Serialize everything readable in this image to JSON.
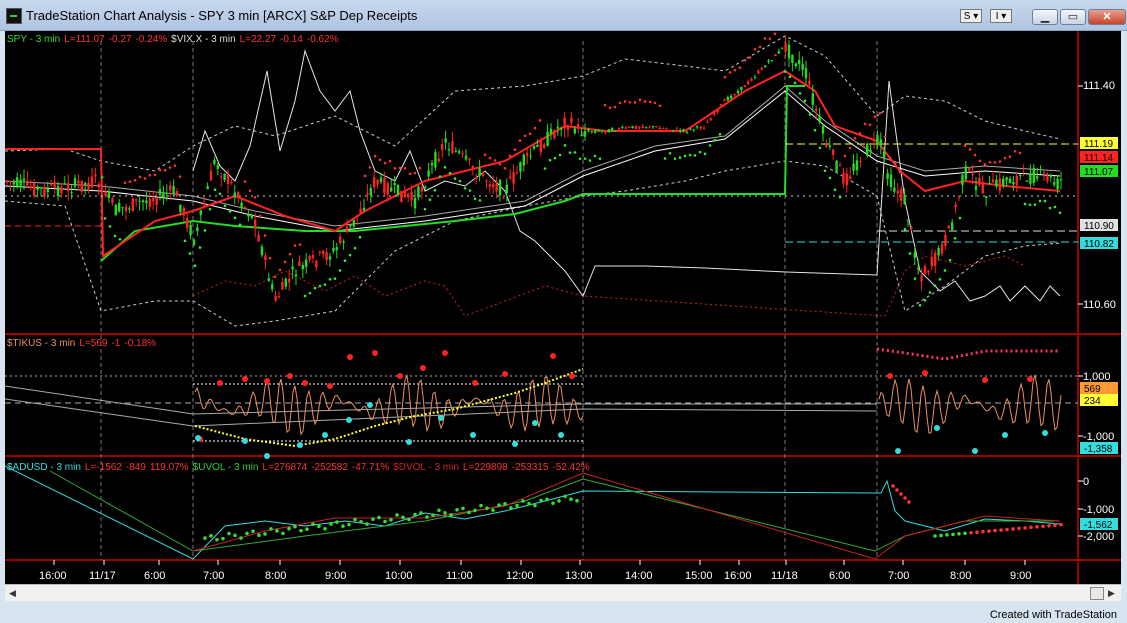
{
  "window": {
    "title": "TradeStation Chart Analysis - SPY 3 min [ARCX] S&P Dep Receipts",
    "symbol_button": "S",
    "layout_button": "I"
  },
  "pane1": {
    "legend": [
      {
        "text": "SPY - 3 min",
        "color": "#33dd33"
      },
      {
        "text": "L=111.07",
        "color": "#ff3333"
      },
      {
        "text": "-0.27",
        "color": "#ff3333"
      },
      {
        "text": "-0.24%",
        "color": "#ff3333"
      },
      {
        "text": "$VIX.X - 3 min",
        "color": "#dddddd"
      },
      {
        "text": "L=22.27",
        "color": "#ff3333"
      },
      {
        "text": "-0.14",
        "color": "#ff3333"
      },
      {
        "text": "-0.62%",
        "color": "#ff3333"
      }
    ],
    "axis_ticks": [
      "111.40",
      "110.60"
    ],
    "markers": [
      {
        "text": "111.19",
        "bg": "#ffff33",
        "fg": "#000000"
      },
      {
        "text": "111.14",
        "bg": "#ff2222",
        "fg": "#000000"
      },
      {
        "text": "111.07",
        "bg": "#22dd22",
        "fg": "#000000"
      },
      {
        "text": "110.90",
        "bg": "#e0e0e0",
        "fg": "#000000"
      },
      {
        "text": "110.82",
        "bg": "#33dddd",
        "fg": "#000000"
      }
    ]
  },
  "pane2": {
    "legend": [
      {
        "text": "$TIKUS - 3 min",
        "color": "#e89060"
      },
      {
        "text": "L=569",
        "color": "#ff3333"
      },
      {
        "text": "-1",
        "color": "#ff3333"
      },
      {
        "text": "-0.18%",
        "color": "#ff3333"
      }
    ],
    "axis_ticks": [
      "1,000",
      "-1,000"
    ],
    "markers": [
      {
        "text": "569",
        "bg": "#ff9933",
        "fg": "#000000"
      },
      {
        "text": "234",
        "bg": "#ffff33",
        "fg": "#000000"
      },
      {
        "text": "-1,358",
        "bg": "#33dddd",
        "fg": "#000000"
      }
    ]
  },
  "pane3": {
    "legend": [
      {
        "text": "$ADUSD - 3 min",
        "color": "#33dddd"
      },
      {
        "text": "L=-1562",
        "color": "#ff3333"
      },
      {
        "text": "-849",
        "color": "#ff3333"
      },
      {
        "text": "119.07%",
        "color": "#ff3333"
      },
      {
        "text": "$UVOL - 3 min",
        "color": "#33cc33"
      },
      {
        "text": "L=276874",
        "color": "#ff3333"
      },
      {
        "text": "-252582",
        "color": "#ff3333"
      },
      {
        "text": "-47.71%",
        "color": "#ff3333"
      },
      {
        "text": "$DVOL - 3 min",
        "color": "#cc2222"
      },
      {
        "text": "L=229898",
        "color": "#ff3333"
      },
      {
        "text": "-253315",
        "color": "#ff3333"
      },
      {
        "text": "-52.42%",
        "color": "#ff3333"
      }
    ],
    "axis_ticks": [
      "0",
      "-1,000",
      "-2,000"
    ],
    "markers": [
      {
        "text": "-1,562",
        "bg": "#33dddd",
        "fg": "#000000"
      }
    ]
  },
  "time_axis": [
    "16:00",
    "11/17",
    "6:00",
    "7:00",
    "8:00",
    "9:00",
    "10:00",
    "11:00",
    "12:00",
    "13:00",
    "14:00",
    "15:00",
    "16:00",
    "11/18",
    "6:00",
    "7:00",
    "8:00",
    "9:00"
  ],
  "footer": "Created with TradeStation"
}
